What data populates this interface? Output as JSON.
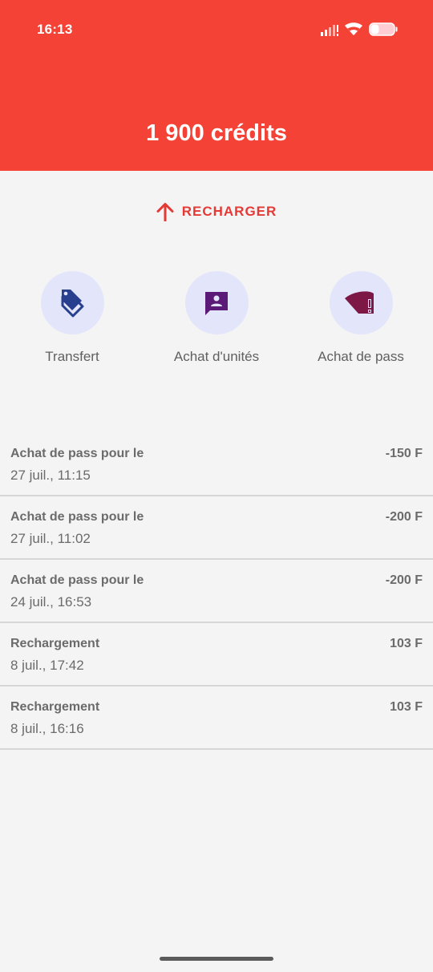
{
  "status_bar": {
    "time": "16:13"
  },
  "header": {
    "balance": "1 900 crédits"
  },
  "recharge": {
    "label": "RECHARGER"
  },
  "actions": [
    {
      "label": "Transfert",
      "icon": "tags-icon"
    },
    {
      "label": "Achat d'unités",
      "icon": "contact-message-icon"
    },
    {
      "label": "Achat de pass",
      "icon": "wifi-alert-icon"
    }
  ],
  "transactions": [
    {
      "title": "Achat de pass pour le",
      "date": "27 juil., 11:15",
      "amount": "-150 F"
    },
    {
      "title": "Achat de pass pour le",
      "date": "27 juil., 11:02",
      "amount": "-200 F"
    },
    {
      "title": "Achat de pass pour le",
      "date": "24 juil., 16:53",
      "amount": "-200 F"
    },
    {
      "title": "Rechargement",
      "date": "8 juil., 17:42",
      "amount": "103 F"
    },
    {
      "title": "Rechargement",
      "date": "8 juil., 16:16",
      "amount": "103 F"
    }
  ],
  "colors": {
    "header": "#f44336",
    "accent": "#e53935",
    "action_bg": "#e3e6fb",
    "transfer_icon": "#283f8f",
    "units_icon": "#5b1a78",
    "pass_icon": "#7d1846"
  }
}
